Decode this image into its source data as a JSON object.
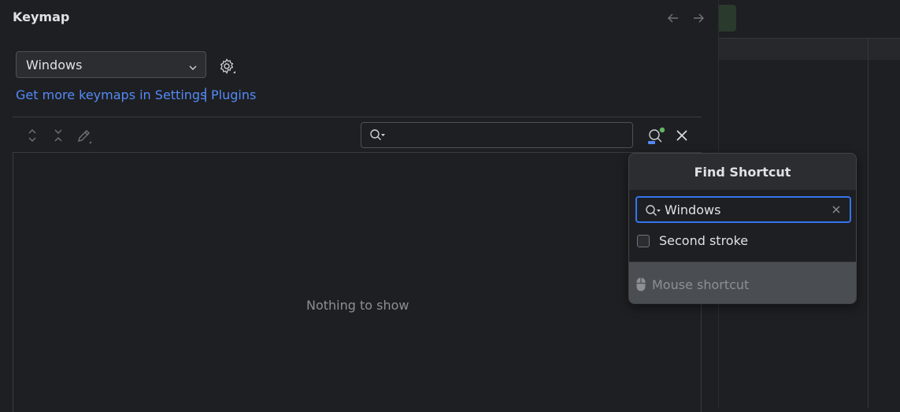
{
  "panel": {
    "title": "Keymap",
    "nav": {
      "back_icon": "arrow-left-icon",
      "forward_icon": "arrow-right-icon"
    },
    "keymap_select": {
      "value": "Windows",
      "icon": "chevron-down-icon"
    },
    "settings_icon": "gear-icon",
    "links": {
      "more_keymaps": "Get more keymaps in Settings",
      "separator": "|",
      "plugins": "Plugins"
    },
    "toolbar": {
      "icons": [
        "expand-all-icon",
        "collapse-all-icon",
        "edit-shortcut-icon"
      ],
      "search": {
        "value": "",
        "icon": "search-icon"
      },
      "find_shortcut_icon": "find-by-shortcut-icon",
      "close_icon": "close-icon"
    },
    "tree": {
      "empty_text": "Nothing to show"
    }
  },
  "popup": {
    "title": "Find Shortcut",
    "shortcut_input": {
      "value": "Windows",
      "icon": "search-icon",
      "clear_icon": "clear-icon"
    },
    "second_stroke": {
      "label": "Second stroke",
      "checked": false
    },
    "mouse_shortcut": {
      "label": "Mouse shortcut",
      "icon": "mouse-icon"
    }
  },
  "colors": {
    "background": "#1e1f22",
    "link": "#548af7",
    "focus_border": "#3574f0",
    "indicator_green": "#5fb865",
    "popup_footer": "#4a4d52"
  }
}
